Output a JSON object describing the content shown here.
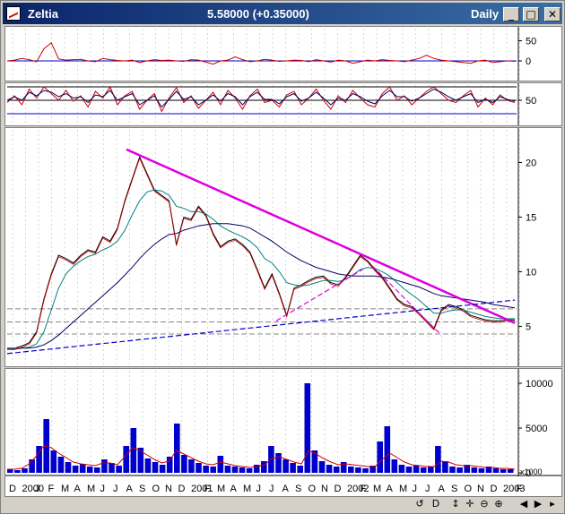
{
  "window": {
    "title": "Zeltia",
    "price_text": "5.58000 (+0.35000)",
    "period": "Daily",
    "controls": {
      "minimize": "_",
      "maximize": "□",
      "close": "✕"
    }
  },
  "toolbar": {
    "icons": [
      "sync-icon",
      "d-label",
      "move-vertical-icon",
      "move-icon",
      "zoom-out-icon",
      "zoom-in-icon",
      "scroll-left-icon",
      "scroll-right-icon",
      "end-icon"
    ],
    "labels": [
      "↺",
      "D",
      "↕",
      "✛",
      "⊖",
      "⊕",
      "◀",
      "▶",
      "▸"
    ]
  },
  "chart_data": [
    {
      "type": "line",
      "panel": "oscillator-1",
      "y_ticks": [
        50,
        0
      ],
      "series": [
        {
          "color": "#cc0000",
          "values": [
            0,
            2,
            6,
            3,
            -2,
            30,
            45,
            5,
            2,
            3,
            4,
            0,
            -2,
            6,
            3,
            1,
            0,
            2,
            -4,
            0,
            3,
            1,
            2,
            0,
            -1,
            3,
            2,
            -3,
            -8,
            0,
            2,
            10,
            3,
            -2,
            0,
            4,
            2,
            -1,
            0,
            2,
            1,
            -2,
            3,
            0,
            -3,
            2,
            0,
            -6,
            -2,
            2,
            0,
            3,
            1,
            0,
            -2,
            2,
            6,
            14,
            6,
            2,
            0,
            -2,
            -4,
            -6,
            0,
            2,
            -4,
            -2,
            0,
            -1
          ]
        }
      ],
      "reference": [
        {
          "value": 0,
          "color": "#0000cc"
        }
      ]
    },
    {
      "type": "line",
      "panel": "oscillator-2",
      "y_ticks": [
        50
      ],
      "series": [
        {
          "color": "#cc0000",
          "values": [
            45,
            60,
            40,
            75,
            55,
            80,
            65,
            50,
            72,
            48,
            60,
            35,
            70,
            55,
            80,
            40,
            60,
            70,
            30,
            50,
            65,
            25,
            55,
            78,
            45,
            60,
            32,
            50,
            68,
            40,
            72,
            55,
            30,
            60,
            75,
            45,
            50,
            35,
            62,
            70,
            40,
            55,
            75,
            50,
            30,
            60,
            45,
            72,
            55,
            40,
            35,
            65,
            80,
            50,
            60,
            40,
            55,
            70,
            80,
            65,
            50,
            45,
            60,
            72,
            35,
            55,
            40,
            62,
            50,
            45
          ]
        },
        {
          "color": "#000066",
          "values": [
            50,
            58,
            50,
            68,
            60,
            72,
            68,
            58,
            65,
            55,
            58,
            45,
            62,
            58,
            72,
            50,
            58,
            65,
            40,
            50,
            60,
            35,
            52,
            70,
            52,
            58,
            40,
            50,
            62,
            48,
            65,
            58,
            40,
            58,
            68,
            52,
            52,
            42,
            58,
            65,
            48,
            55,
            68,
            55,
            40,
            55,
            50,
            65,
            58,
            48,
            42,
            60,
            72,
            58,
            58,
            48,
            55,
            65,
            75,
            68,
            58,
            50,
            58,
            65,
            45,
            52,
            45,
            58,
            52,
            48
          ]
        }
      ],
      "reference": [
        {
          "value": 80,
          "color": "#000000"
        },
        {
          "value": 50,
          "color": "#000000"
        },
        {
          "value": 20,
          "color": "#0000cc"
        }
      ]
    },
    {
      "type": "line",
      "panel": "price",
      "y_ticks": [
        20,
        15,
        10,
        5
      ],
      "ylim": [
        2,
        22.5
      ],
      "x_ticks": [
        "D",
        "2000",
        "J",
        "F",
        "M",
        "A",
        "M",
        "J",
        "J",
        "A",
        "S",
        "O",
        "N",
        "D",
        "2001",
        "F",
        "M",
        "A",
        "M",
        "J",
        "J",
        "A",
        "S",
        "O",
        "N",
        "D",
        "2002",
        "F",
        "M",
        "A",
        "M",
        "J",
        "J",
        "A",
        "S",
        "O",
        "N",
        "D",
        "2003",
        "F"
      ],
      "series": [
        {
          "color": "#000000",
          "values": [
            3,
            3,
            3.2,
            3.5,
            4.5,
            7.5,
            9.8,
            11.5,
            11.2,
            10.8,
            11.5,
            12,
            11.8,
            13.2,
            12.8,
            14,
            16.5,
            18.5,
            20.5,
            19,
            17.5,
            17,
            16.5,
            12.5,
            15,
            14.8,
            16,
            15.2,
            13.5,
            12.3,
            12.8,
            13,
            12.5,
            11.8,
            10.2,
            8.5,
            9.8,
            8,
            6,
            8.5,
            8.8,
            9.2,
            9.5,
            9.6,
            9,
            8.8,
            9.5,
            10.5,
            11.5,
            11,
            10.2,
            9.5,
            8.5,
            7.5,
            7,
            6.8,
            6.2,
            5.5,
            4.8,
            6.5,
            7,
            6.8,
            6.5,
            6,
            5.8,
            5.6,
            5.5,
            5.5,
            5.6,
            5.58
          ]
        },
        {
          "color": "#008080",
          "values": [
            3,
            3,
            3,
            3.1,
            3.4,
            4.5,
            6.5,
            8.5,
            9.8,
            10.5,
            11,
            11.4,
            11.6,
            12,
            12.3,
            12.8,
            13.8,
            15.2,
            16.5,
            17.3,
            17.5,
            17.4,
            17,
            16,
            15.8,
            15.5,
            15.5,
            15.3,
            14.8,
            14.2,
            13.8,
            13.5,
            13.2,
            12.8,
            12.2,
            11.2,
            10.8,
            10,
            9,
            8.8,
            8.7,
            8.8,
            9,
            9.2,
            9.2,
            9.1,
            9.3,
            9.7,
            10.2,
            10.4,
            10.3,
            10,
            9.6,
            9,
            8.4,
            7.9,
            7.4,
            6.8,
            6.2,
            6.2,
            6.4,
            6.5,
            6.5,
            6.3,
            6.1,
            5.9,
            5.8,
            5.7,
            5.7,
            5.7
          ]
        },
        {
          "color": "#000066",
          "values": [
            2.9,
            2.9,
            3,
            3,
            3.1,
            3.3,
            3.7,
            4.2,
            4.8,
            5.4,
            6,
            6.6,
            7.2,
            7.8,
            8.4,
            9,
            9.7,
            10.4,
            11.2,
            11.9,
            12.5,
            13,
            13.4,
            13.5,
            13.8,
            14,
            14.2,
            14.3,
            14.4,
            14.4,
            14.4,
            14.3,
            14.2,
            14,
            13.6,
            13.2,
            12.8,
            12.3,
            11.8,
            11.4,
            11,
            10.7,
            10.4,
            10.2,
            10,
            9.8,
            9.7,
            9.6,
            9.6,
            9.6,
            9.6,
            9.5,
            9.4,
            9.2,
            9,
            8.8,
            8.6,
            8.3,
            8,
            7.8,
            7.7,
            7.6,
            7.5,
            7.4,
            7.3,
            7.2,
            7,
            6.9,
            6.8,
            6.7
          ]
        }
      ],
      "trendlines": [
        {
          "color": "#dd00dd",
          "from": [
            0.235,
            21.2
          ],
          "to": [
            1.0,
            5.3
          ]
        },
        {
          "color": "#0000cc",
          "from": [
            0.0,
            2.5
          ],
          "to": [
            1.0,
            7.4
          ]
        },
        {
          "color": "#dd00dd",
          "from": [
            0.53,
            5.5
          ],
          "to": [
            0.7,
            10.2
          ]
        },
        {
          "color": "#dd00dd",
          "from": [
            0.72,
            10.5
          ],
          "to": [
            0.855,
            4.2
          ]
        }
      ],
      "reference": [
        {
          "value": 6.6,
          "color": "#888888"
        },
        {
          "value": 5.4,
          "color": "#888888"
        },
        {
          "value": 4.3,
          "color": "#888888"
        }
      ]
    },
    {
      "type": "bar",
      "panel": "volume",
      "y_ticks": [
        10000,
        5000,
        0
      ],
      "unit": "x1000",
      "ylim": [
        0,
        11000
      ],
      "values": [
        400,
        300,
        500,
        1500,
        3000,
        6000,
        2500,
        1800,
        1200,
        800,
        1000,
        700,
        600,
        1500,
        1100,
        800,
        3000,
        5000,
        2800,
        1600,
        1200,
        900,
        1800,
        5500,
        2000,
        1500,
        1100,
        800,
        700,
        1900,
        800,
        700,
        600,
        500,
        900,
        1300,
        3000,
        2200,
        1500,
        1100,
        800,
        10000,
        2500,
        1300,
        900,
        700,
        1200,
        700,
        600,
        500,
        800,
        3500,
        5200,
        1500,
        900,
        700,
        800,
        600,
        700,
        3000,
        1300,
        700,
        600,
        900,
        600,
        500,
        700,
        500,
        400,
        400
      ],
      "series": [
        {
          "color": "#cc0000",
          "values": [
            400,
            400,
            500,
            1000,
            1900,
            3000,
            2800,
            2200,
            1700,
            1200,
            1000,
            900,
            800,
            1100,
            1100,
            900,
            1800,
            2800,
            2500,
            2000,
            1500,
            1100,
            1300,
            2500,
            2100,
            1700,
            1300,
            1000,
            900,
            1200,
            1000,
            800,
            700,
            600,
            700,
            900,
            1600,
            1800,
            1500,
            1200,
            1000,
            2500,
            2100,
            1600,
            1200,
            900,
            1000,
            900,
            800,
            700,
            700,
            1500,
            2200,
            1700,
            1200,
            900,
            800,
            700,
            700,
            1300,
            1200,
            900,
            800,
            800,
            700,
            600,
            600,
            500,
            500,
            400
          ]
        }
      ]
    }
  ]
}
